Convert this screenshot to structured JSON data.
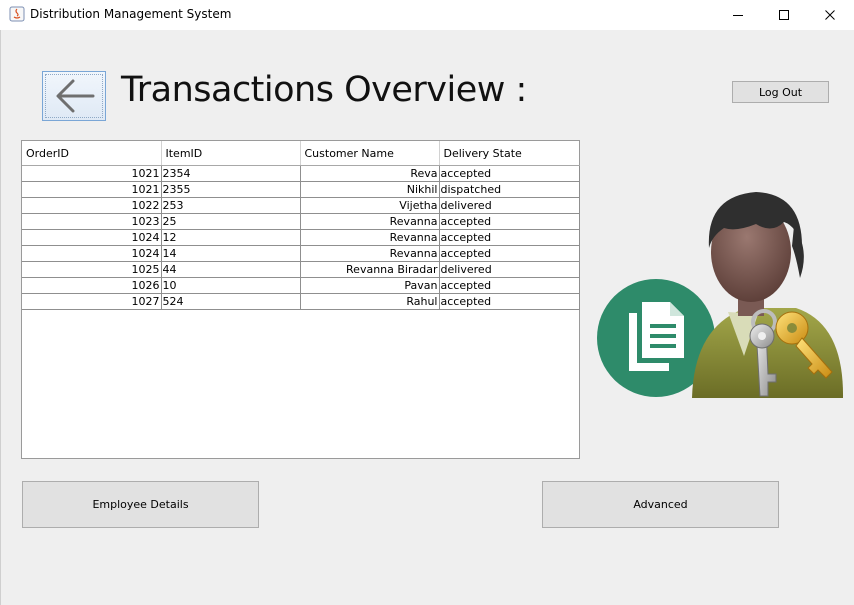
{
  "window": {
    "title": "Distribution Management System",
    "minimize_icon": "minimize-icon",
    "maximize_icon": "maximize-icon",
    "close_icon": "close-icon"
  },
  "header": {
    "back_icon": "arrow-left-icon",
    "title": "Transactions Overview :",
    "logout_label": "Log Out"
  },
  "table": {
    "columns": [
      "OrderID",
      "ItemID",
      "Customer Name",
      "Delivery State"
    ],
    "rows": [
      [
        "1021",
        "2354",
        "Reva",
        "accepted"
      ],
      [
        "1021",
        "2355",
        "Nikhil",
        "dispatched"
      ],
      [
        "1022",
        "253",
        "Vijetha",
        "delivered"
      ],
      [
        "1023",
        "25",
        "Revanna",
        "accepted"
      ],
      [
        "1024",
        "12",
        "Revanna",
        "accepted"
      ],
      [
        "1024",
        "14",
        "Revanna",
        "accepted"
      ],
      [
        "1025",
        "44",
        "Revanna Biradar",
        "delivered"
      ],
      [
        "1026",
        "10",
        "Pavan",
        "accepted"
      ],
      [
        "1027",
        "524",
        "Rahul",
        "accepted"
      ]
    ]
  },
  "footer": {
    "employee_details_label": "Employee Details",
    "advanced_label": "Advanced"
  },
  "illustration": {
    "icon": "user-document-keys-icon",
    "circle_color": "#2e8b6a",
    "jacket_color": "#8a8c3a"
  }
}
